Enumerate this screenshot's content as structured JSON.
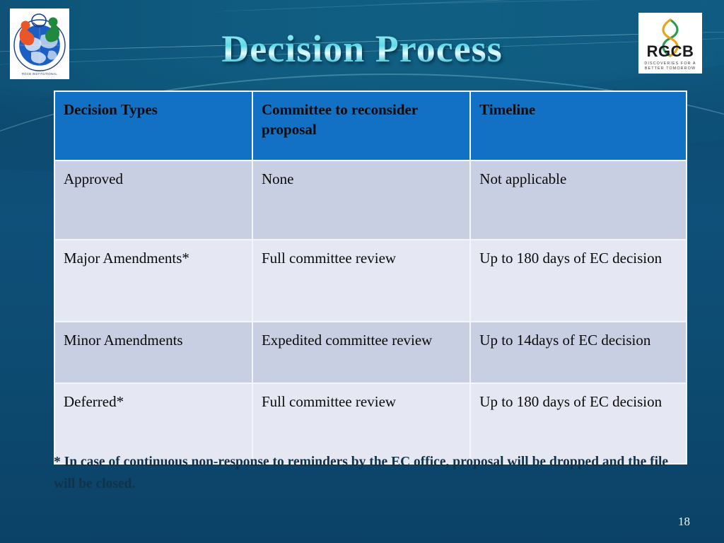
{
  "slide": {
    "title": "Decision Process",
    "page_number": "18",
    "accent_header": "#1271c5",
    "row_shade_dark": "#c9cfe2",
    "row_shade_light": "#e5e8f2",
    "background_top": "#1c9fb5",
    "background_bottom": "#0b4167",
    "title_color": "#7fe2ef"
  },
  "logos": {
    "left": {
      "name": "RGCB Institutional Human Ethics Committee emblem",
      "ring_text": "RGCB INSTITUTIONAL HUMAN ETHICS COMMITTEE"
    },
    "right": {
      "name": "RGCB logo",
      "wordmark": "RGCB",
      "tagline_line1": "DISCOVERIES FOR A",
      "tagline_line2": "BETTER TOMORROW"
    }
  },
  "table": {
    "headers": [
      "Decision Types",
      "Committee to reconsider proposal",
      "Timeline"
    ],
    "rows": [
      {
        "decision_type": "Approved",
        "committee": "None",
        "timeline": "Not applicable"
      },
      {
        "decision_type": "Major Amendments*",
        "committee": "Full committee review",
        "timeline": "Up to 180 days of EC decision"
      },
      {
        "decision_type": "Minor Amendments",
        "committee": "Expedited committee review",
        "timeline": "Up to 14days of EC decision"
      },
      {
        "decision_type": "Deferred*",
        "committee": "Full committee review",
        "timeline": "Up to 180 days of EC decision"
      }
    ]
  },
  "footnote": {
    "text": "* In case of continuous non-response to reminders by the EC office, proposal will be dropped and the file will be closed."
  }
}
